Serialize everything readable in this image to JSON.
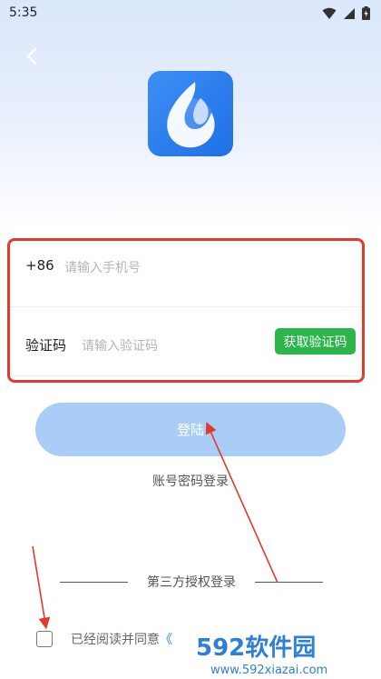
{
  "status_bar": {
    "time": "5:35"
  },
  "form": {
    "country_code": "+86",
    "phone_placeholder": "请输入手机号",
    "code_label": "验证码",
    "code_placeholder": "请输入验证码",
    "get_code_button": "获取验证码"
  },
  "login_button": "登陆",
  "password_login_link": "账号密码登录",
  "third_party_label": "第三方授权登录",
  "agreement": {
    "text": "已经阅读并同意",
    "link": "《"
  },
  "watermark": {
    "brand": "592软件园",
    "url": "www.592xiazai.com"
  },
  "colors": {
    "accent_blue": "#a9cdf7",
    "green_button": "#2bb54a",
    "annotation_red": "#e23a2c"
  }
}
